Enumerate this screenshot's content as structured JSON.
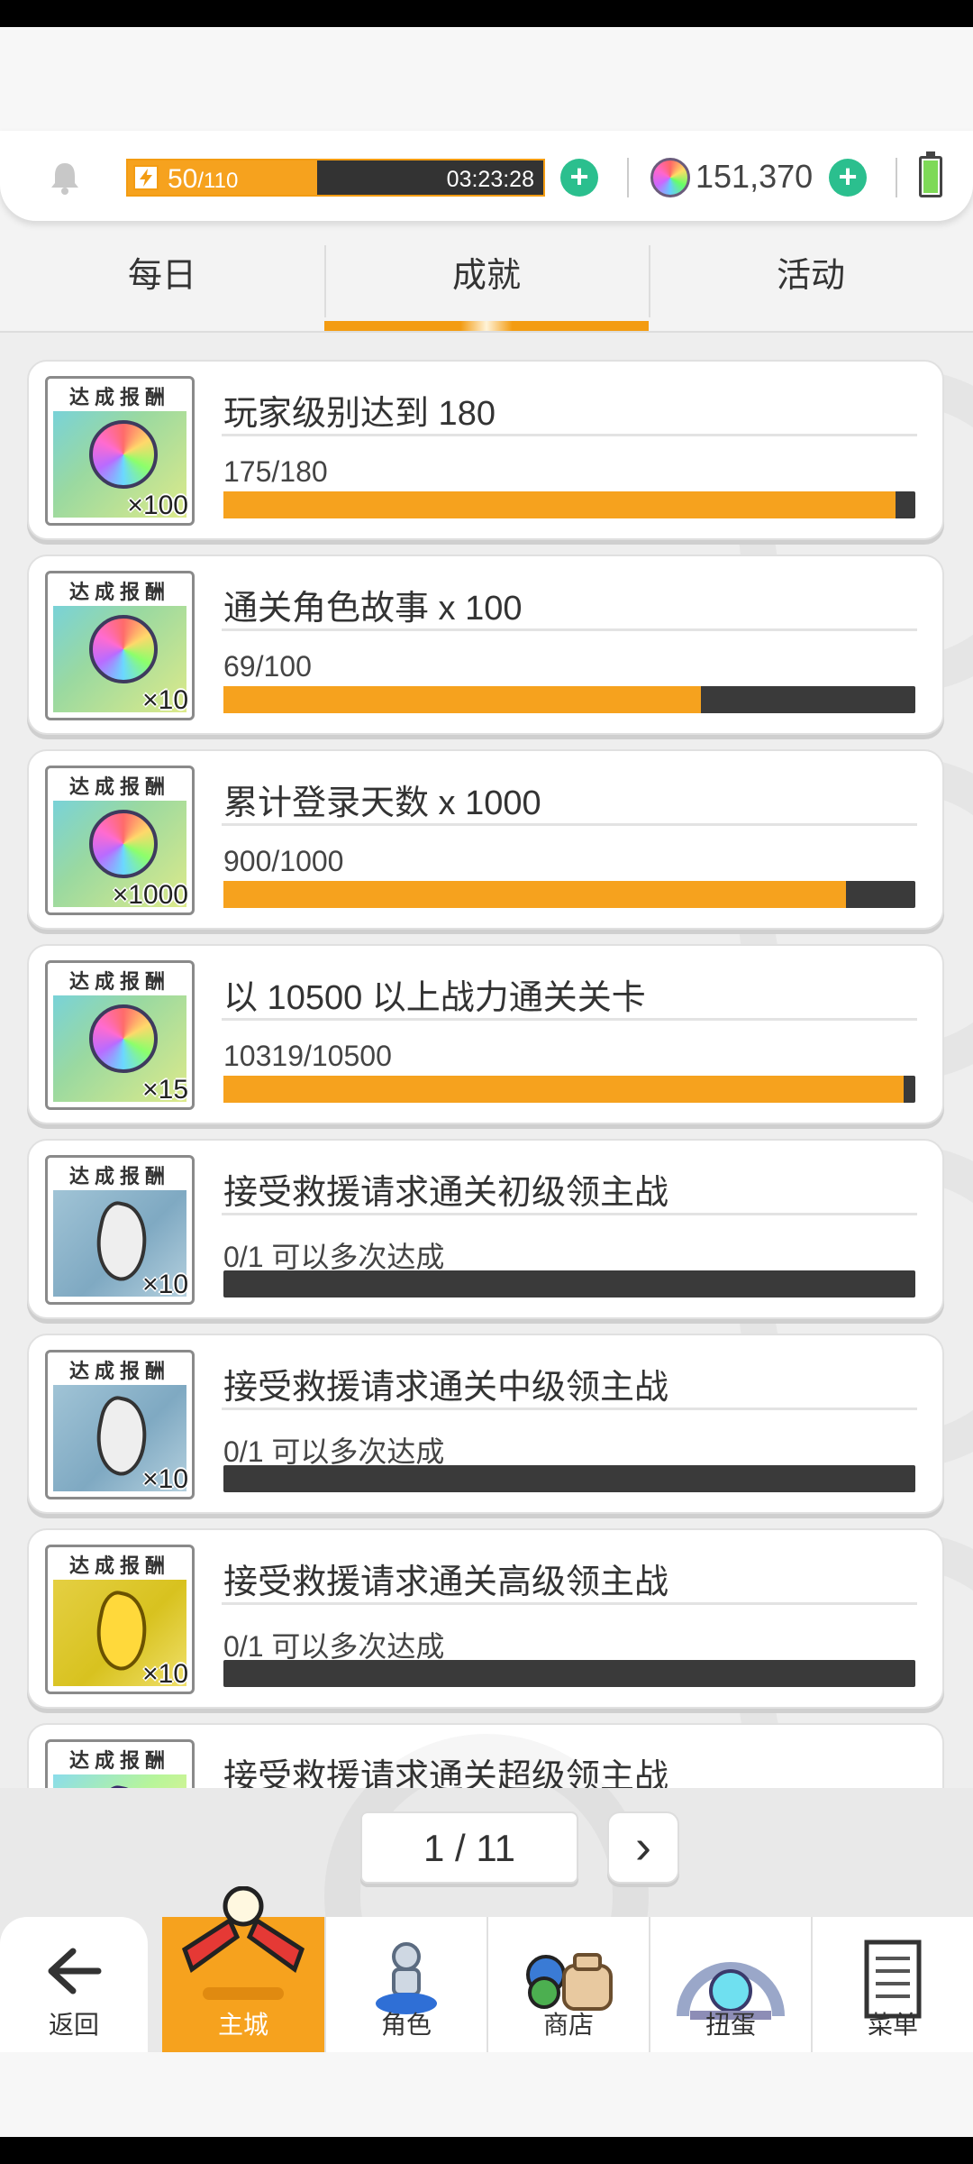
{
  "hud": {
    "stamina_current": "50",
    "stamina_max": "/110",
    "stamina_fraction": 0.4545,
    "stamina_timer": "03:23:28",
    "gem_count": "151,370",
    "plus": "+"
  },
  "tabs": [
    {
      "label": "每日",
      "active": false
    },
    {
      "label": "成就",
      "active": true
    },
    {
      "label": "活动",
      "active": false
    }
  ],
  "reward_label": "达成报酬",
  "achievements": [
    {
      "title": "玩家级别达到 180",
      "progress_text": "175/180",
      "progress": 0.972,
      "reward_qty": "×100",
      "reward": "gem"
    },
    {
      "title": "通关角色故事  x 100",
      "progress_text": "69/100",
      "progress": 0.69,
      "reward_qty": "×10",
      "reward": "gem"
    },
    {
      "title": "累计登录天数  x 1000",
      "progress_text": "900/1000",
      "progress": 0.9,
      "reward_qty": "×1000",
      "reward": "gem"
    },
    {
      "title": "以 10500 以上战力通关关卡",
      "progress_text": "10319/10500",
      "progress": 0.983,
      "reward_qty": "×15",
      "reward": "gem"
    },
    {
      "title": "接受救援请求通关初级领主战",
      "progress_text": "0/1    可以多次达成",
      "progress": 0,
      "reward_qty": "×10",
      "reward": "stone-blue"
    },
    {
      "title": "接受救援请求通关中级领主战",
      "progress_text": "0/1    可以多次达成",
      "progress": 0,
      "reward_qty": "×10",
      "reward": "stone-blue"
    },
    {
      "title": "接受救援请求通关高级领主战",
      "progress_text": "0/1    可以多次达成",
      "progress": 0,
      "reward_qty": "×10",
      "reward": "stone-gold"
    },
    {
      "title": "接受救援请求通关超级领主战",
      "progress_text": "",
      "progress": 0,
      "reward_qty": "",
      "reward": "stone-rainbow"
    }
  ],
  "pager": {
    "text": "1 / 11",
    "next": "›"
  },
  "nav": [
    {
      "label": "返回",
      "icon": "back-arrow-icon"
    },
    {
      "label": "主城",
      "icon": "main-city-icon",
      "active": true
    },
    {
      "label": "角色",
      "icon": "character-icon"
    },
    {
      "label": "商店",
      "icon": "shop-icon"
    },
    {
      "label": "扭蛋",
      "icon": "gacha-icon"
    },
    {
      "label": "菜单",
      "icon": "menu-list-icon"
    }
  ],
  "colors": {
    "accent": "#f6a21e",
    "bar_bg": "#3a3a3a",
    "plus": "#2bbf8e"
  }
}
